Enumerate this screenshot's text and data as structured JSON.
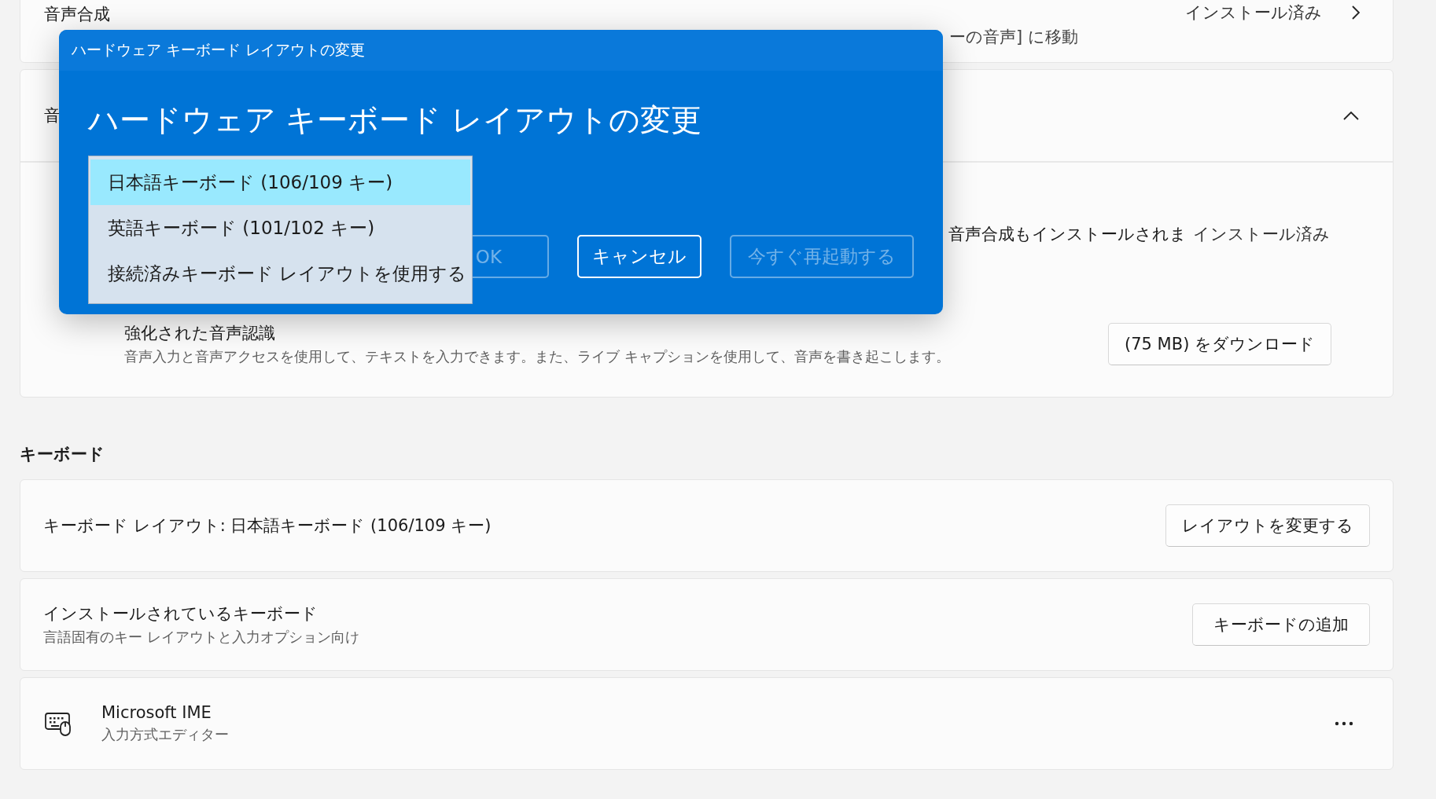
{
  "speech_card": {
    "title": "音声合成",
    "description": "ーの音声] に移動",
    "status": "インストール済み"
  },
  "recognition_card": {
    "header": "音",
    "expanded": true,
    "rows": [
      {
        "kind": "status",
        "description": "音声合成もインストールされま",
        "status": "インストール済み"
      },
      {
        "kind": "action",
        "title": "強化された音声認識",
        "description": "音声入力と音声アクセスを使用して、テキストを入力できます。また、ライブ キャプションを使用して、音声を書き起こします。",
        "button": "(75 MB) をダウンロード"
      }
    ]
  },
  "keyboard_section": {
    "heading": "キーボード",
    "layout_card": {
      "label": "キーボード レイアウト: 日本語キーボード (106/109 キー)",
      "button": "レイアウトを変更する"
    },
    "installed_card": {
      "title": "インストールされているキーボード",
      "description": "言語固有のキー レイアウトと入力オプション向け",
      "button": "キーボードの追加"
    },
    "keyboards": [
      {
        "name": "Microsoft IME",
        "description": "入力方式エディター"
      }
    ]
  },
  "dialog": {
    "titlebar": "ハードウェア キーボード レイアウトの変更",
    "heading": "ハードウェア キーボード レイアウトの変更",
    "options": [
      {
        "label": "日本語キーボード (106/109 キー)",
        "selected": true
      },
      {
        "label": "英語キーボード (101/102 キー)",
        "selected": false
      },
      {
        "label": "接続済みキーボード レイアウトを使用する",
        "selected": false
      }
    ],
    "buttons": [
      {
        "label": "OK",
        "disabled": true
      },
      {
        "label": "キャンセル",
        "disabled": false
      },
      {
        "label": "今すぐ再起動する",
        "disabled": true
      }
    ]
  }
}
